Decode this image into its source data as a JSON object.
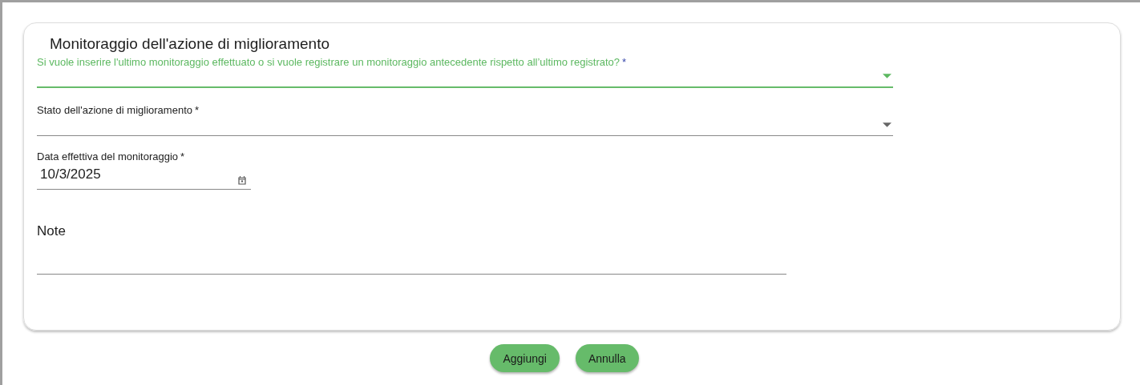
{
  "card": {
    "title": "Monitoraggio dell'azione di miglioramento"
  },
  "fields": [
    {
      "kind": "select",
      "label": "Si vuole inserire l'ultimo monitoraggio effettuato o si vuole registrare un monitoraggio antecedente rispetto all’ultimo registrato?",
      "required_mark": "*",
      "focused": true
    },
    {
      "kind": "select",
      "label": "Stato dell'azione di miglioramento",
      "required_mark": "*",
      "focused": false
    },
    {
      "kind": "date",
      "label": "Data effettiva del monitoraggio",
      "required_mark": "*",
      "value": "10/3/2025",
      "focused": false
    },
    {
      "kind": "textarea",
      "label": "Note",
      "focused": false
    }
  ],
  "buttons": [
    "Aggiungi",
    "Annulla"
  ]
}
